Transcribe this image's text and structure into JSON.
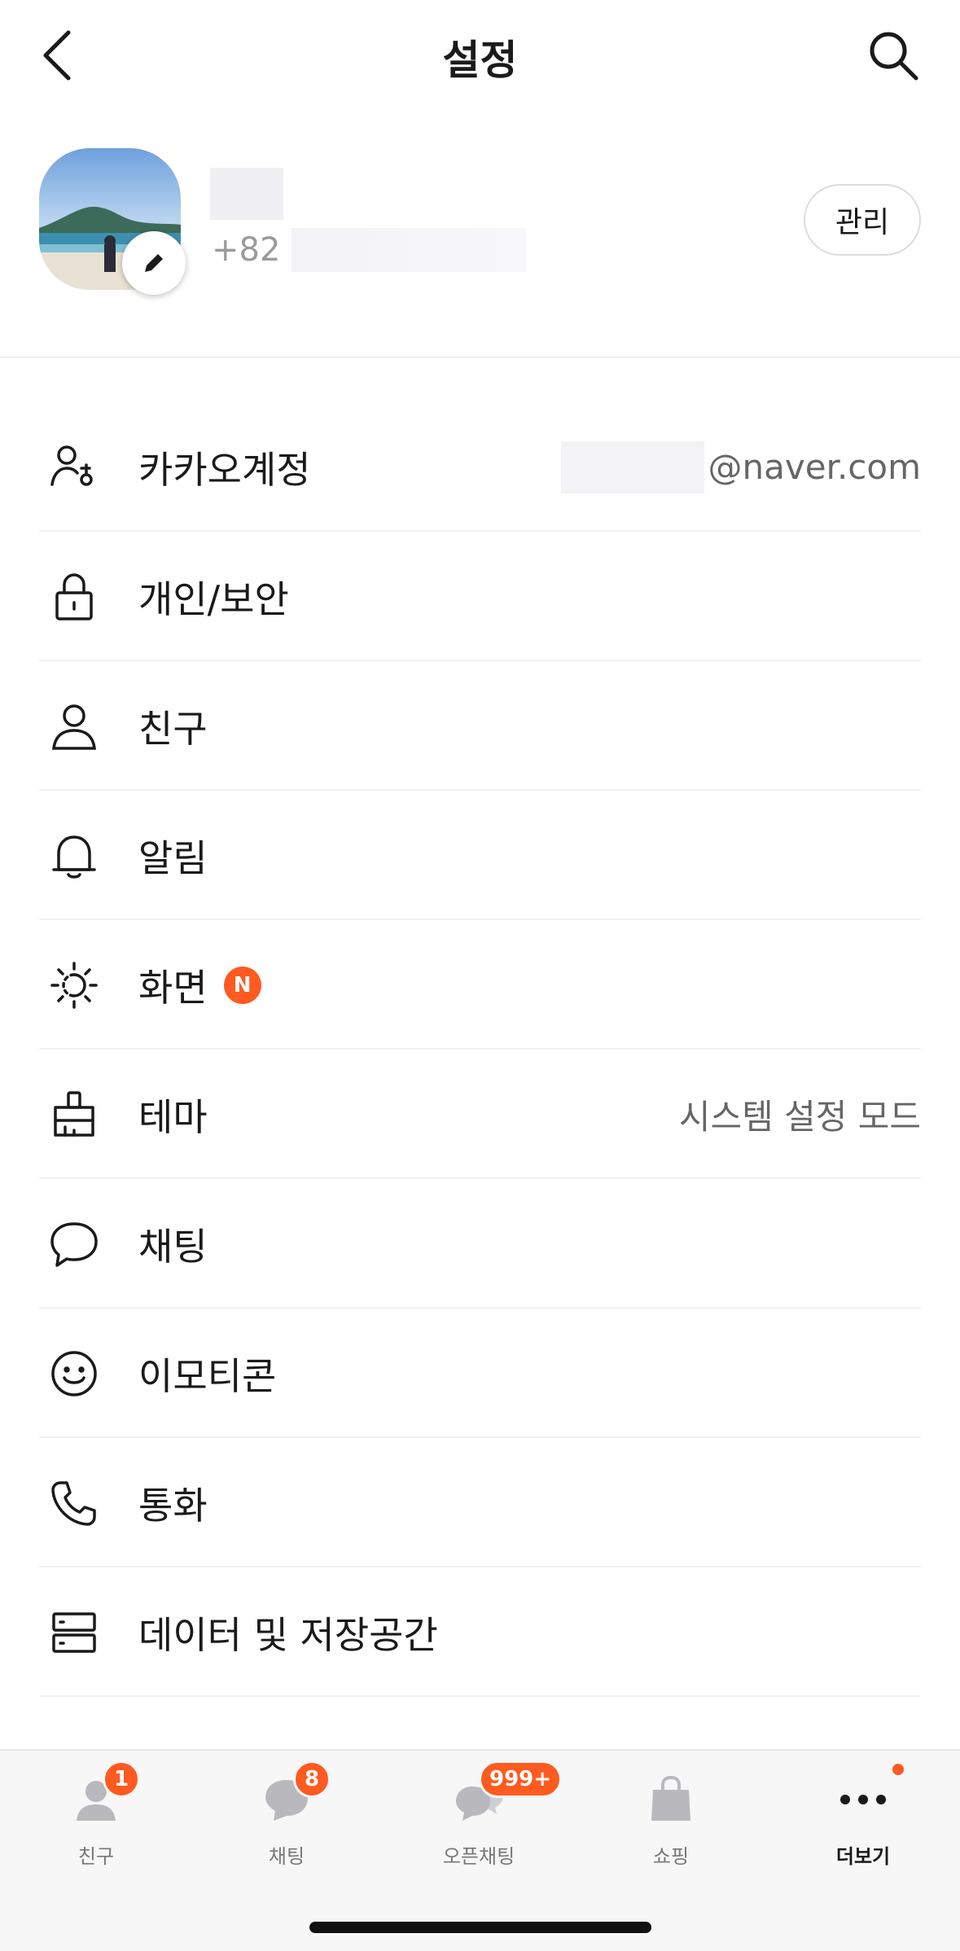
{
  "header": {
    "title": "설정",
    "back_icon": "chevron-left-icon",
    "search_icon": "search-icon"
  },
  "profile": {
    "phone_prefix": "+82",
    "manage_label": "관리"
  },
  "menu": {
    "items": [
      {
        "label": "카카오계정",
        "icon": "account-icon",
        "value": "@naver.com"
      },
      {
        "label": "개인/보안",
        "icon": "lock-icon",
        "value": ""
      },
      {
        "label": "친구",
        "icon": "person-icon",
        "value": ""
      },
      {
        "label": "알림",
        "icon": "bell-icon",
        "value": ""
      },
      {
        "label": "화면",
        "icon": "brightness-icon",
        "value": "",
        "badge": "N"
      },
      {
        "label": "테마",
        "icon": "theme-brush-icon",
        "value": "시스템 설정 모드"
      },
      {
        "label": "채팅",
        "icon": "chat-bubble-icon",
        "value": ""
      },
      {
        "label": "이모티콘",
        "icon": "smiley-icon",
        "value": ""
      },
      {
        "label": "통화",
        "icon": "phone-icon",
        "value": ""
      },
      {
        "label": "데이터 및 저장공간",
        "icon": "storage-icon",
        "value": ""
      }
    ]
  },
  "tabbar": {
    "tabs": [
      {
        "label": "친구",
        "badge": "1",
        "icon": "friends-tab-icon"
      },
      {
        "label": "채팅",
        "badge": "8",
        "icon": "chat-tab-icon"
      },
      {
        "label": "오픈채팅",
        "badge": "999+",
        "icon": "openchat-tab-icon"
      },
      {
        "label": "쇼핑",
        "badge": "",
        "icon": "shopping-bag-icon"
      },
      {
        "label": "더보기",
        "badge": "",
        "icon": "more-dots-icon",
        "active": true
      }
    ]
  },
  "colors": {
    "accent": "#ff5a1f",
    "text": "#1a1a1a",
    "muted": "#9a9a9a",
    "tabbar_bg": "#f7f7f7"
  }
}
